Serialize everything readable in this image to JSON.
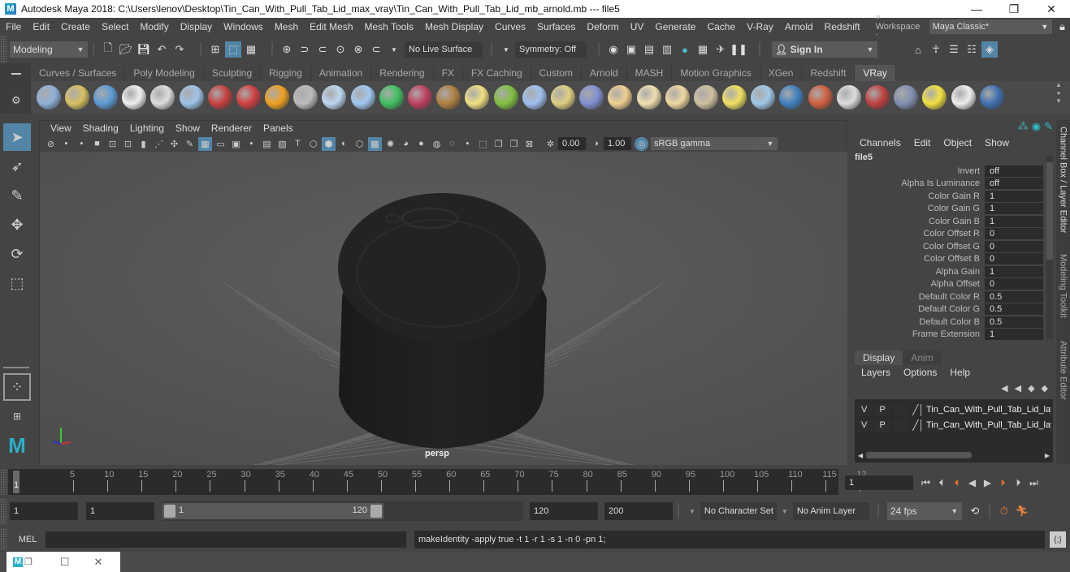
{
  "window": {
    "title": "Autodesk Maya 2018: C:\\Users\\lenov\\Desktop\\Tin_Can_With_Pull_Tab_Lid_max_vray\\Tin_Can_With_Pull_Tab_Lid_mb_arnold.mb  ---  file5",
    "controls": {
      "minimize": "—",
      "restore": "❐",
      "close": "✕"
    }
  },
  "menubar": {
    "items": [
      "File",
      "Edit",
      "Create",
      "Select",
      "Modify",
      "Display",
      "Windows",
      "Mesh",
      "Edit Mesh",
      "Mesh Tools",
      "Mesh Display",
      "Curves",
      "Surfaces",
      "Deform",
      "UV",
      "Generate",
      "Cache",
      "V-Ray",
      "Arnold",
      "Redshift"
    ],
    "workspace_label": "» Workspace :",
    "workspace_value": "Maya Classic*"
  },
  "statusline": {
    "mode": "Modeling",
    "live_surface": "No Live Surface",
    "symmetry": "Symmetry: Off",
    "sign_in": "Sign In"
  },
  "shelf": {
    "tabs": [
      "Curves / Surfaces",
      "Poly Modeling",
      "Sculpting",
      "Rigging",
      "Animation",
      "Rendering",
      "FX",
      "FX Caching",
      "Custom",
      "Arnold",
      "MASH",
      "Motion Graphics",
      "XGen",
      "Redshift",
      "VRay"
    ],
    "active_tab": "VRay",
    "icons": [
      {
        "name": "save-scene-icon",
        "color": "#8fb0d8"
      },
      {
        "name": "export-icon",
        "color": "#d8c060"
      },
      {
        "name": "settings-list-icon",
        "color": "#5b9bd5"
      },
      {
        "name": "vray-logo-icon",
        "color": "#eeeeee"
      },
      {
        "name": "frame-buffer-icon",
        "color": "#dddddd"
      },
      {
        "name": "sphere-fade-icon",
        "color": "#9ec4e8"
      },
      {
        "name": "camera-icon",
        "color": "#c84040"
      },
      {
        "name": "materials-icon",
        "color": "#d04040"
      },
      {
        "name": "fire-icon",
        "color": "#f0a020"
      },
      {
        "name": "proxy-icon",
        "color": "#bbbbbb"
      },
      {
        "name": "box-icon",
        "color": "#bcd6f0"
      },
      {
        "name": "cone-icon",
        "color": "#a0c8f0"
      },
      {
        "name": "plane-light-icon",
        "color": "#40c060"
      },
      {
        "name": "fur-icon",
        "color": "#c04060"
      },
      {
        "name": "texture-icon",
        "color": "#b08040"
      },
      {
        "name": "dome-grid-icon",
        "color": "#f0e080"
      },
      {
        "name": "grass-icon",
        "color": "#80c040"
      },
      {
        "name": "particles-icon",
        "color": "#a0c0f0"
      },
      {
        "name": "spline-icon",
        "color": "#e0d080"
      },
      {
        "name": "globe-icon",
        "color": "#8090d0"
      },
      {
        "name": "dome-light-icon",
        "color": "#f0d090"
      },
      {
        "name": "spot-light-icon",
        "color": "#f0e0b0"
      },
      {
        "name": "sphere-light-icon",
        "color": "#f0d8a0"
      },
      {
        "name": "ies-light-icon",
        "color": "#d0c0a0"
      },
      {
        "name": "sun-icon",
        "color": "#f0e060"
      },
      {
        "name": "sky-icon",
        "color": "#a0c8e8"
      },
      {
        "name": "blue-sphere-icon",
        "color": "#4080c0"
      },
      {
        "name": "multi-sphere-icon",
        "color": "#d06040"
      },
      {
        "name": "checker-icon",
        "color": "#dddddd"
      },
      {
        "name": "render-view-icon",
        "color": "#c04040"
      },
      {
        "name": "render-settings-icon",
        "color": "#8090b0"
      },
      {
        "name": "light-editor-icon",
        "color": "#f0e040"
      },
      {
        "name": "cloud-icon",
        "color": "#eeeeee"
      },
      {
        "name": "help-icon",
        "color": "#4070b0"
      }
    ]
  },
  "viewport": {
    "menus": [
      "View",
      "Shading",
      "Lighting",
      "Show",
      "Renderer",
      "Panels"
    ],
    "exposure": "0.00",
    "gamma": "1.00",
    "color_space": "sRGB gamma",
    "camera_label": "persp"
  },
  "channel_box": {
    "menus": [
      "Channels",
      "Edit",
      "Object",
      "Show"
    ],
    "node_name": "file5",
    "attributes": [
      {
        "label": "Invert",
        "value": "off"
      },
      {
        "label": "Alpha Is Luminance",
        "value": "off"
      },
      {
        "label": "Color Gain R",
        "value": "1"
      },
      {
        "label": "Color Gain G",
        "value": "1"
      },
      {
        "label": "Color Gain B",
        "value": "1"
      },
      {
        "label": "Color Offset R",
        "value": "0"
      },
      {
        "label": "Color Offset G",
        "value": "0"
      },
      {
        "label": "Color Offset B",
        "value": "0"
      },
      {
        "label": "Alpha Gain",
        "value": "1"
      },
      {
        "label": "Alpha Offset",
        "value": "0"
      },
      {
        "label": "Default Color R",
        "value": "0.5"
      },
      {
        "label": "Default Color G",
        "value": "0.5"
      },
      {
        "label": "Default Color B",
        "value": "0.5"
      },
      {
        "label": "Frame Extension",
        "value": "1"
      }
    ]
  },
  "side_tabs": [
    "Channel Box / Layer Editor",
    "Modeling Toolkit",
    "Attribute Editor"
  ],
  "layer_editor": {
    "tabs": [
      "Display",
      "Anim"
    ],
    "active_tab": "Display",
    "menus": [
      "Layers",
      "Options",
      "Help"
    ],
    "layers": [
      {
        "v": "V",
        "p": "P",
        "name": "Tin_Can_With_Pull_Tab_Lid_lay"
      },
      {
        "v": "V",
        "p": "P",
        "name": "Tin_Can_With_Pull_Tab_Lid_lay"
      }
    ]
  },
  "timeline": {
    "ticks": [
      "5",
      "10",
      "15",
      "20",
      "25",
      "30",
      "35",
      "40",
      "45",
      "50",
      "55",
      "60",
      "65",
      "70",
      "75",
      "80",
      "85",
      "90",
      "95",
      "100",
      "105",
      "110",
      "115",
      "12"
    ],
    "current_frame_marker": "1",
    "current_frame": "1"
  },
  "range": {
    "start": "1",
    "playback_start": "1",
    "slider_start": "1",
    "slider_end": "120",
    "playback_end": "120",
    "end": "200",
    "character_set": "No Character Set",
    "anim_layer": "No Anim Layer",
    "fps": "24 fps"
  },
  "command_line": {
    "language": "MEL",
    "input": "",
    "result": "makeIdentity -apply true -t 1 -r 1 -s 1 -n 0 -pn 1;"
  }
}
